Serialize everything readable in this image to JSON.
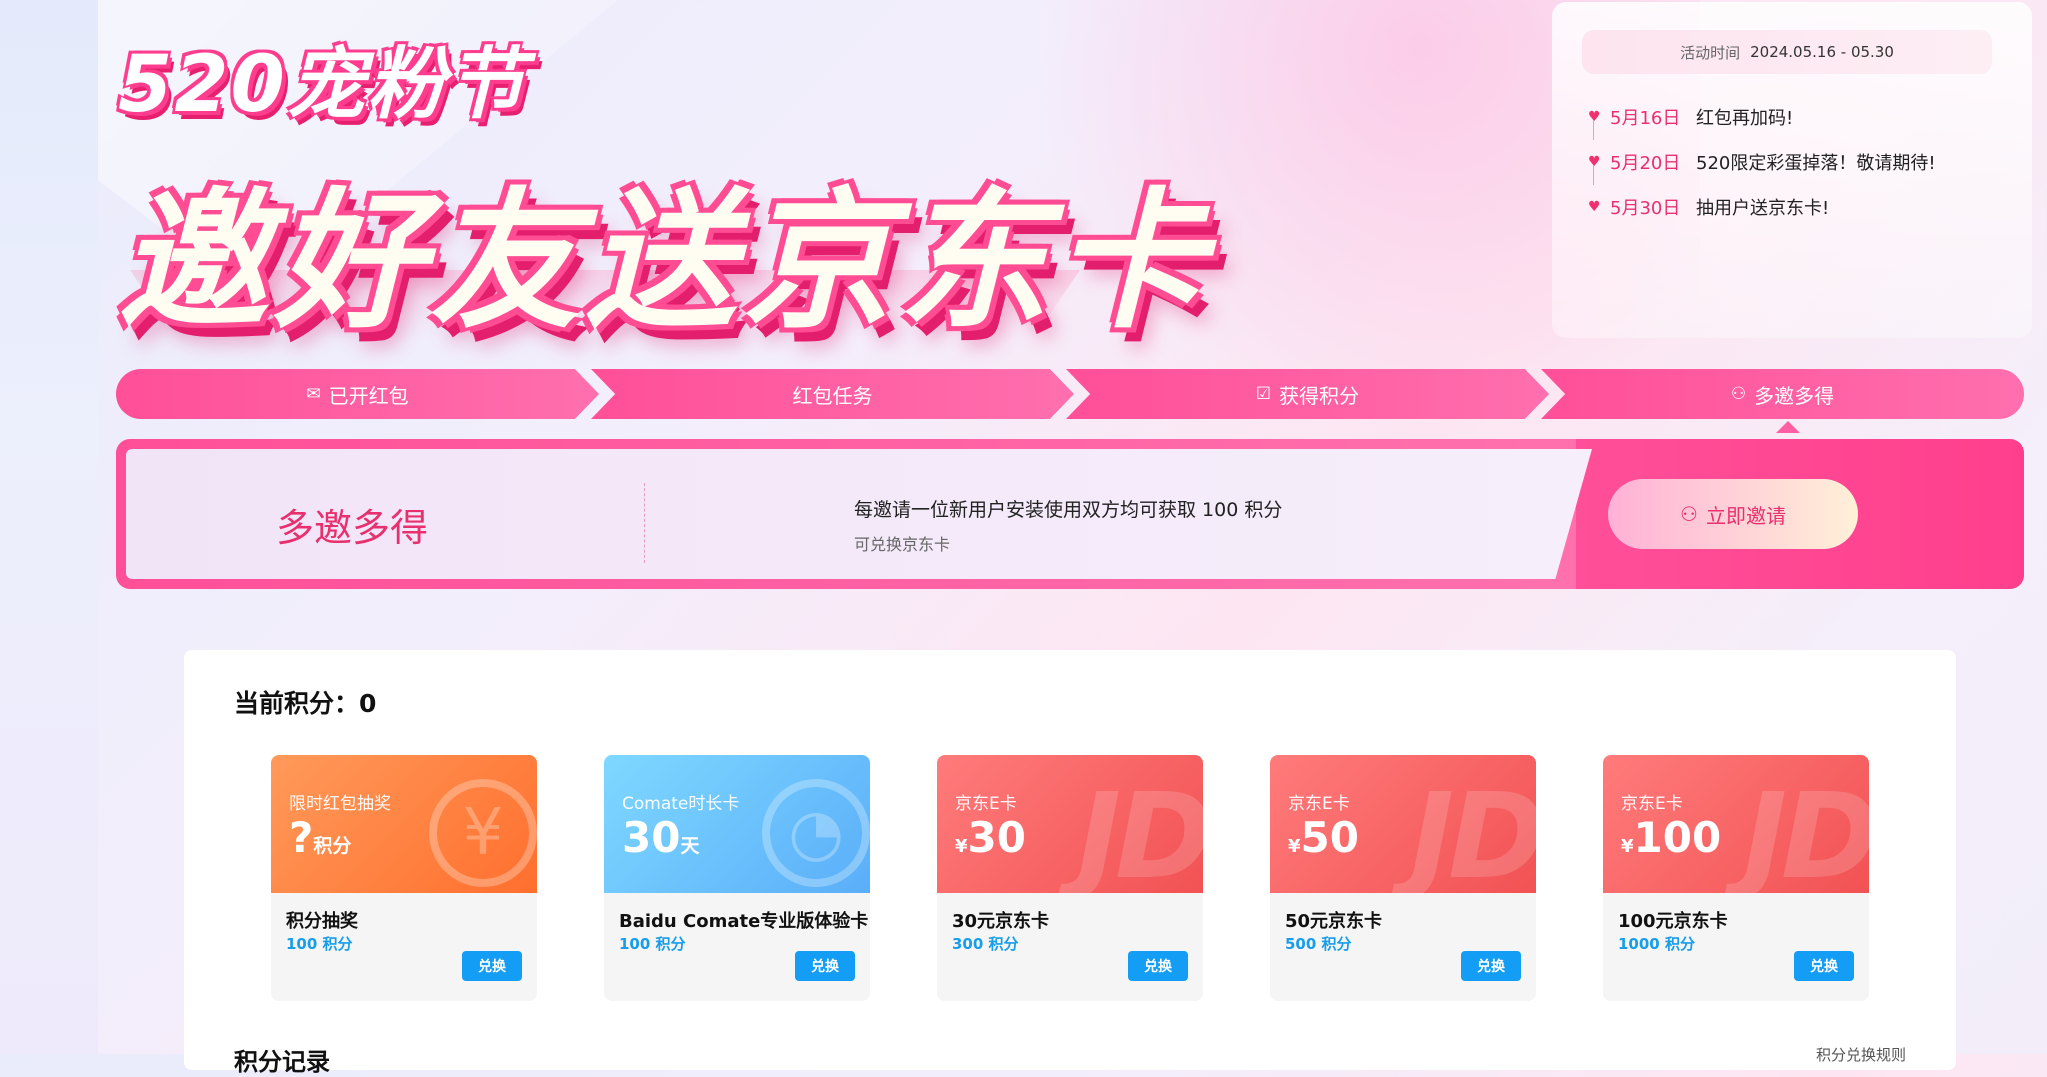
{
  "hero": {
    "subtitle": "520宠粉节",
    "title": "邀好友送京东卡"
  },
  "schedule": {
    "time_label": "活动时间",
    "time_value": "2024.05.16 - 05.30",
    "items": [
      {
        "date": "5月16日",
        "text": "红包再加码!"
      },
      {
        "date": "5月20日",
        "text": "520限定彩蛋掉落！敬请期待!"
      },
      {
        "date": "5月30日",
        "text": "抽用户送京东卡!"
      }
    ]
  },
  "tabs": [
    {
      "label": "已开红包",
      "icon": "envelope-icon"
    },
    {
      "label": "红包任务",
      "icon": ""
    },
    {
      "label": "获得积分",
      "icon": "checkbox-icon"
    },
    {
      "label": "多邀多得",
      "icon": "users-icon"
    }
  ],
  "active_tab": "多邀多得",
  "invite": {
    "title": "多邀多得",
    "description": "每邀请一位新用户安装使用双方均可获取 100 积分",
    "note": "可兑换京东卡",
    "button": "立即邀请"
  },
  "points": {
    "label": "当前积分：0"
  },
  "prizes": [
    {
      "tag": "限时红包抽奖",
      "big": "?",
      "unit": "积分",
      "currency": "",
      "name": "积分抽奖",
      "cost": "100 积分",
      "button": "兑换",
      "theme": "orange",
      "icon": "yen-icon"
    },
    {
      "tag": "Comate时长卡",
      "big": "30",
      "unit": "天",
      "currency": "",
      "name": "Baidu Comate专业版体验卡",
      "cost": "100 积分",
      "button": "兑换",
      "theme": "blue",
      "icon": "clock-icon"
    },
    {
      "tag": "京东E卡",
      "big": "30",
      "unit": "",
      "currency": "¥",
      "name": "30元京东卡",
      "cost": "300 积分",
      "button": "兑换",
      "theme": "red",
      "icon": "jd-icon"
    },
    {
      "tag": "京东E卡",
      "big": "50",
      "unit": "",
      "currency": "¥",
      "name": "50元京东卡",
      "cost": "500 积分",
      "button": "兑换",
      "theme": "red",
      "icon": "jd-icon"
    },
    {
      "tag": "京东E卡",
      "big": "100",
      "unit": "",
      "currency": "¥",
      "name": "100元京东卡",
      "cost": "1000 积分",
      "button": "兑换",
      "theme": "red",
      "icon": "jd-icon"
    }
  ],
  "records": {
    "title": "积分记录",
    "rule_link": "积分兑换规则"
  },
  "colors": {
    "accent_pink": "#ff4f98",
    "title_pink": "#e8306e",
    "cost_blue": "#189dea",
    "button_blue": "#139df5"
  }
}
